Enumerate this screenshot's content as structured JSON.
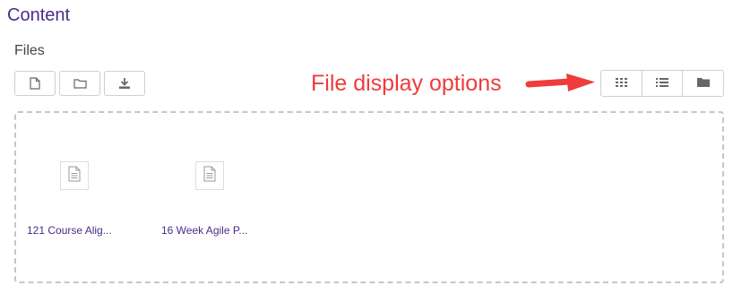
{
  "section": {
    "title": "Content"
  },
  "files": {
    "label": "Files"
  },
  "toolbar": {
    "buttons": [
      {
        "icon": "file-icon"
      },
      {
        "icon": "folder-icon"
      },
      {
        "icon": "download-icon"
      }
    ]
  },
  "annotation": {
    "text": "File display options",
    "color": "#ef3b3b"
  },
  "view_options": [
    {
      "icon": "grid-icon"
    },
    {
      "icon": "list-icon"
    },
    {
      "icon": "folder-tree-icon"
    }
  ],
  "file_items": [
    {
      "name": "121 Course Alig..."
    },
    {
      "name": "16 Week Agile P..."
    }
  ],
  "colors": {
    "accent": "#4a2b8a",
    "border": "#cfcfcf"
  }
}
